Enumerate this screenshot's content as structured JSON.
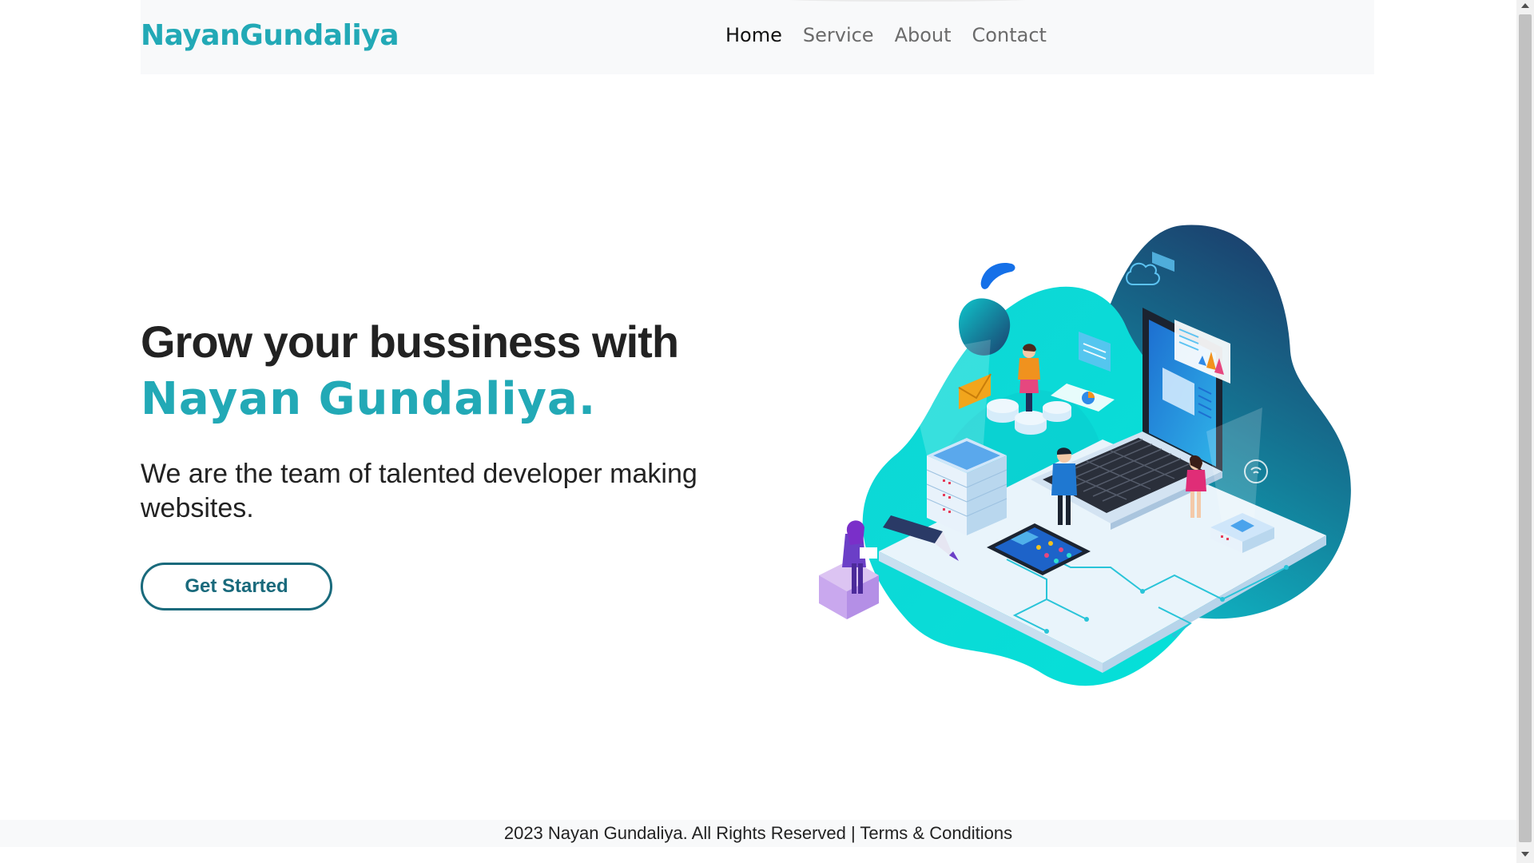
{
  "navbar": {
    "brand": "NayanGundaliya",
    "links": [
      {
        "label": "Home",
        "active": true
      },
      {
        "label": "Service",
        "active": false
      },
      {
        "label": "About",
        "active": false
      },
      {
        "label": "Contact",
        "active": false
      }
    ]
  },
  "hero": {
    "headline": "Grow your bussiness with",
    "brand_line": "Nayan Gundaliya.",
    "subtitle": "We are the team of talented developer making websites.",
    "cta_label": "Get Started",
    "illustration_icon": "isometric-tech-illustration"
  },
  "footer": {
    "text": "2023 Nayan Gundaliya. All Rights Reserved | Terms & Conditions"
  },
  "colors": {
    "brand": "#22a9b6",
    "button_border": "#196a7c",
    "navbar_bg": "#f8f9fa",
    "text": "#222222",
    "nav_inactive": "#6b6b6b"
  }
}
